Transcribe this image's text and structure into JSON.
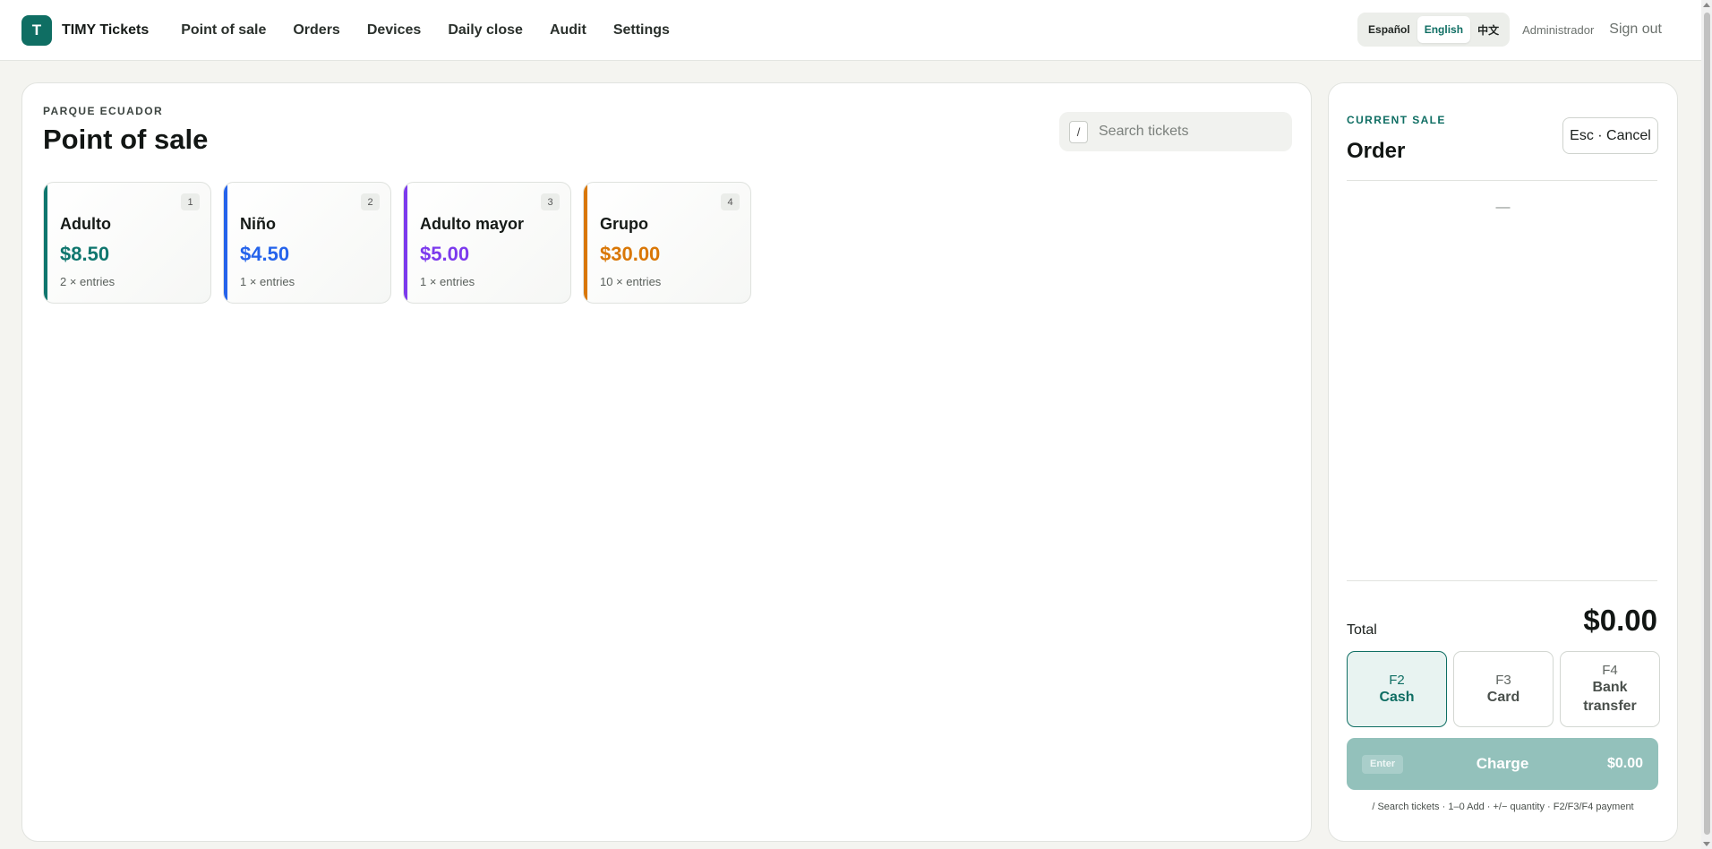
{
  "brand": {
    "logo_letter": "T",
    "name": "TIMY Tickets"
  },
  "nav": {
    "items": [
      {
        "label": "Point of sale"
      },
      {
        "label": "Orders"
      },
      {
        "label": "Devices"
      },
      {
        "label": "Daily close"
      },
      {
        "label": "Audit"
      },
      {
        "label": "Settings"
      }
    ]
  },
  "languages": {
    "options": [
      "Español",
      "English",
      "中文"
    ],
    "selected": "English"
  },
  "user": {
    "name": "Administrador",
    "signout_label": "Sign out"
  },
  "pos": {
    "location": "PARQUE ECUADOR",
    "title": "Point of sale",
    "search": {
      "key_hint": "/",
      "placeholder": "Search tickets",
      "value": ""
    },
    "tickets": [
      {
        "key": "1",
        "name": "Adulto",
        "price": "$8.50",
        "entries": "2 × entries",
        "color": "#0f766e"
      },
      {
        "key": "2",
        "name": "Niño",
        "price": "$4.50",
        "entries": "1 × entries",
        "color": "#2563eb"
      },
      {
        "key": "3",
        "name": "Adulto mayor",
        "price": "$5.00",
        "entries": "1 × entries",
        "color": "#7c3aed"
      },
      {
        "key": "4",
        "name": "Grupo",
        "price": "$30.00",
        "entries": "10 × entries",
        "color": "#d97706"
      }
    ]
  },
  "order": {
    "section_label": "CURRENT SALE",
    "title": "Order",
    "cancel_label": "Esc · Cancel",
    "empty_text": "—",
    "total_label": "Total",
    "total_value": "$0.00",
    "payment_methods": [
      {
        "key": "F2",
        "label": "Cash",
        "selected": true
      },
      {
        "key": "F3",
        "label": "Card",
        "selected": false
      },
      {
        "key": "F4",
        "label": "Bank transfer",
        "selected": false
      }
    ],
    "charge": {
      "key_hint": "Enter",
      "label": "Charge",
      "amount": "$0.00"
    },
    "shortcuts_hint": "/ Search tickets · 1–0 Add · +/− quantity · F2/F3/F4 payment"
  },
  "colors": {
    "accent": "#0f6e63",
    "charge_button": "#93c1bb",
    "background": "#f4f4f0"
  }
}
